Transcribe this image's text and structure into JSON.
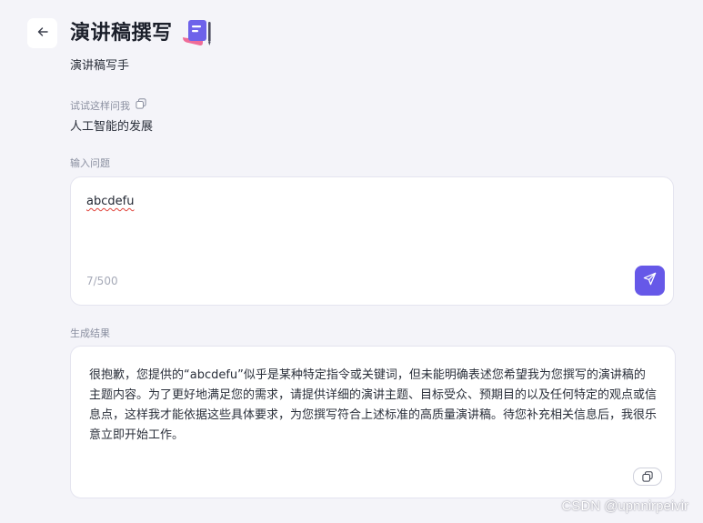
{
  "header": {
    "title": "演讲稿撰写",
    "subtitle": "演讲稿写手",
    "back_icon": "arrow-left-icon",
    "title_icon": "notebook-pen-icon"
  },
  "example": {
    "label": "试试这样问我",
    "copy_icon": "copy-icon",
    "text": "人工智能的发展"
  },
  "input": {
    "label": "输入问题",
    "value": "abcdefu",
    "counter": "7/500",
    "send_icon": "send-icon"
  },
  "result": {
    "label": "生成结果",
    "text": "很抱歉，您提供的“abcdefu”似乎是某种特定指令或关键词，但未能明确表述您希望我为您撰写的演讲稿的主题内容。为了更好地满足您的需求，请提供详细的演讲主题、目标受众、预期目的以及任何特定的观点或信息点，这样我才能依据这些具体要求，为您撰写符合上述标准的高质量演讲稿。待您补充相关信息后，我很乐意立即开始工作。",
    "copy_icon": "copy-icon"
  },
  "watermark": "CSDN @upnnirpeivir",
  "colors": {
    "accent": "#6658e8",
    "background": "#f4f4f9",
    "misspelling_underline": "#e0433b"
  }
}
